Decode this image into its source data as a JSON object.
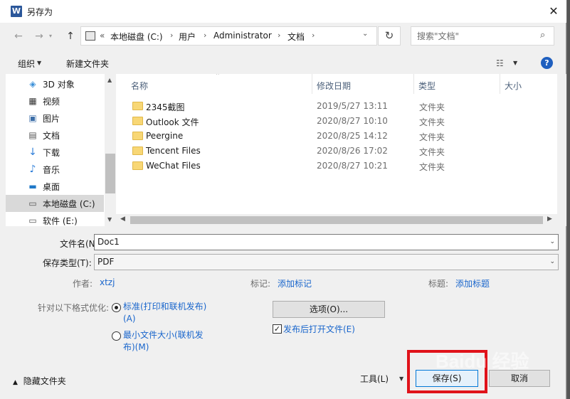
{
  "window": {
    "title": "另存为",
    "close_glyph": "✕",
    "app_icon_letter": "W"
  },
  "nav": {
    "back": "←",
    "forward": "→",
    "up": "↑",
    "breadcrumb": [
      "«",
      "本地磁盘 (C:)",
      "用户",
      "Administrator",
      "文档"
    ],
    "refresh": "↻",
    "search_placeholder": "搜索\"文档\""
  },
  "toolbar": {
    "organize": "组织",
    "new_folder": "新建文件夹",
    "help": "?"
  },
  "sidebar": {
    "items": [
      {
        "label": "3D 对象",
        "icon": "cube-icon"
      },
      {
        "label": "视频",
        "icon": "video-icon"
      },
      {
        "label": "图片",
        "icon": "pictures-icon"
      },
      {
        "label": "文档",
        "icon": "documents-icon"
      },
      {
        "label": "下载",
        "icon": "download-icon"
      },
      {
        "label": "音乐",
        "icon": "music-icon"
      },
      {
        "label": "桌面",
        "icon": "desktop-icon"
      },
      {
        "label": "本地磁盘 (C:)",
        "icon": "drive-icon",
        "selected": true
      },
      {
        "label": "软件 (E:)",
        "icon": "drive-icon"
      }
    ]
  },
  "files": {
    "columns": {
      "name": "名称",
      "date": "修改日期",
      "type": "类型",
      "size": "大小"
    },
    "rows": [
      {
        "name": "2345截图",
        "date": "2019/5/27 13:11",
        "type": "文件夹"
      },
      {
        "name": "Outlook 文件",
        "date": "2020/8/27 10:10",
        "type": "文件夹"
      },
      {
        "name": "Peergine",
        "date": "2020/8/25 14:12",
        "type": "文件夹"
      },
      {
        "name": "Tencent Files",
        "date": "2020/8/26 17:02",
        "type": "文件夹"
      },
      {
        "name": "WeChat Files",
        "date": "2020/8/27 10:21",
        "type": "文件夹"
      }
    ]
  },
  "form": {
    "filename_label": "文件名(N):",
    "filename_value": "Doc1",
    "filetype_label": "保存类型(T):",
    "filetype_value": "PDF",
    "author_label": "作者:",
    "author_value": "xtzj",
    "tags_label": "标记:",
    "tags_value": "添加标记",
    "title_label": "标题:",
    "title_value": "添加标题"
  },
  "optimize": {
    "label": "针对以下格式优化:",
    "standard_line1": "标准(打印和联机发布)",
    "standard_line2": "(A)",
    "minimum_line1": "最小文件大小(联机发",
    "minimum_line2": "布)(M)",
    "options_button": "选项(O)...",
    "open_after": "发布后打开文件(E)"
  },
  "footer": {
    "hide_folders": "隐藏文件夹",
    "tools": "工具(L)",
    "save": "保存(S)",
    "cancel": "取消"
  },
  "watermark": "Baidu 经验",
  "colors": {
    "highlight": "#e0121a",
    "link": "#1a66cc",
    "help": "#1f5fbf"
  }
}
